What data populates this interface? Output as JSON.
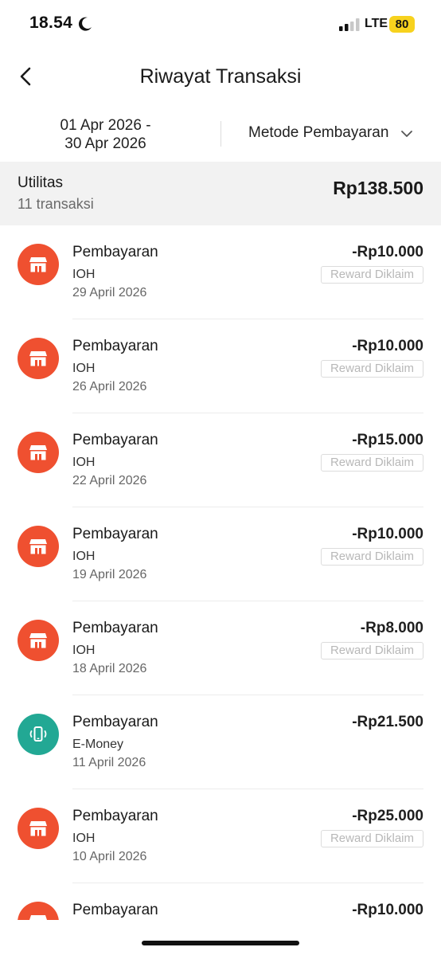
{
  "status_bar": {
    "time": "18.54",
    "network": "LTE",
    "battery": "80"
  },
  "header": {
    "title": "Riwayat Transaksi"
  },
  "filters": {
    "date_line1": "01 Apr 2026 -",
    "date_line2": "30 Apr 2026",
    "payment_method": "Metode Pembayaran"
  },
  "summary": {
    "category": "Utilitas",
    "count": "11 transaksi",
    "total": "Rp138.500"
  },
  "colors": {
    "store_icon": "#ef5030",
    "emoney_icon": "#22a894",
    "accent_battery": "#f7d21e"
  },
  "transactions": [
    {
      "title": "Pembayaran",
      "merchant": "IOH",
      "date": "29 April 2026",
      "amount": "-Rp10.000",
      "badge": "Reward Diklaim",
      "icon": "store-icon"
    },
    {
      "title": "Pembayaran",
      "merchant": "IOH",
      "date": "26 April 2026",
      "amount": "-Rp10.000",
      "badge": "Reward Diklaim",
      "icon": "store-icon"
    },
    {
      "title": "Pembayaran",
      "merchant": "IOH",
      "date": "22 April 2026",
      "amount": "-Rp15.000",
      "badge": "Reward Diklaim",
      "icon": "store-icon"
    },
    {
      "title": "Pembayaran",
      "merchant": "IOH",
      "date": "19 April 2026",
      "amount": "-Rp10.000",
      "badge": "Reward Diklaim",
      "icon": "store-icon"
    },
    {
      "title": "Pembayaran",
      "merchant": "IOH",
      "date": "18 April 2026",
      "amount": "-Rp8.000",
      "badge": "Reward Diklaim",
      "icon": "store-icon"
    },
    {
      "title": "Pembayaran",
      "merchant": "E-Money",
      "date": "11 April 2026",
      "amount": "-Rp21.500",
      "badge": "",
      "icon": "phone-icon"
    },
    {
      "title": "Pembayaran",
      "merchant": "IOH",
      "date": "10 April 2026",
      "amount": "-Rp25.000",
      "badge": "Reward Diklaim",
      "icon": "store-icon"
    },
    {
      "title": "Pembayaran",
      "amount": "-Rp10.000",
      "icon": "store-icon"
    }
  ]
}
